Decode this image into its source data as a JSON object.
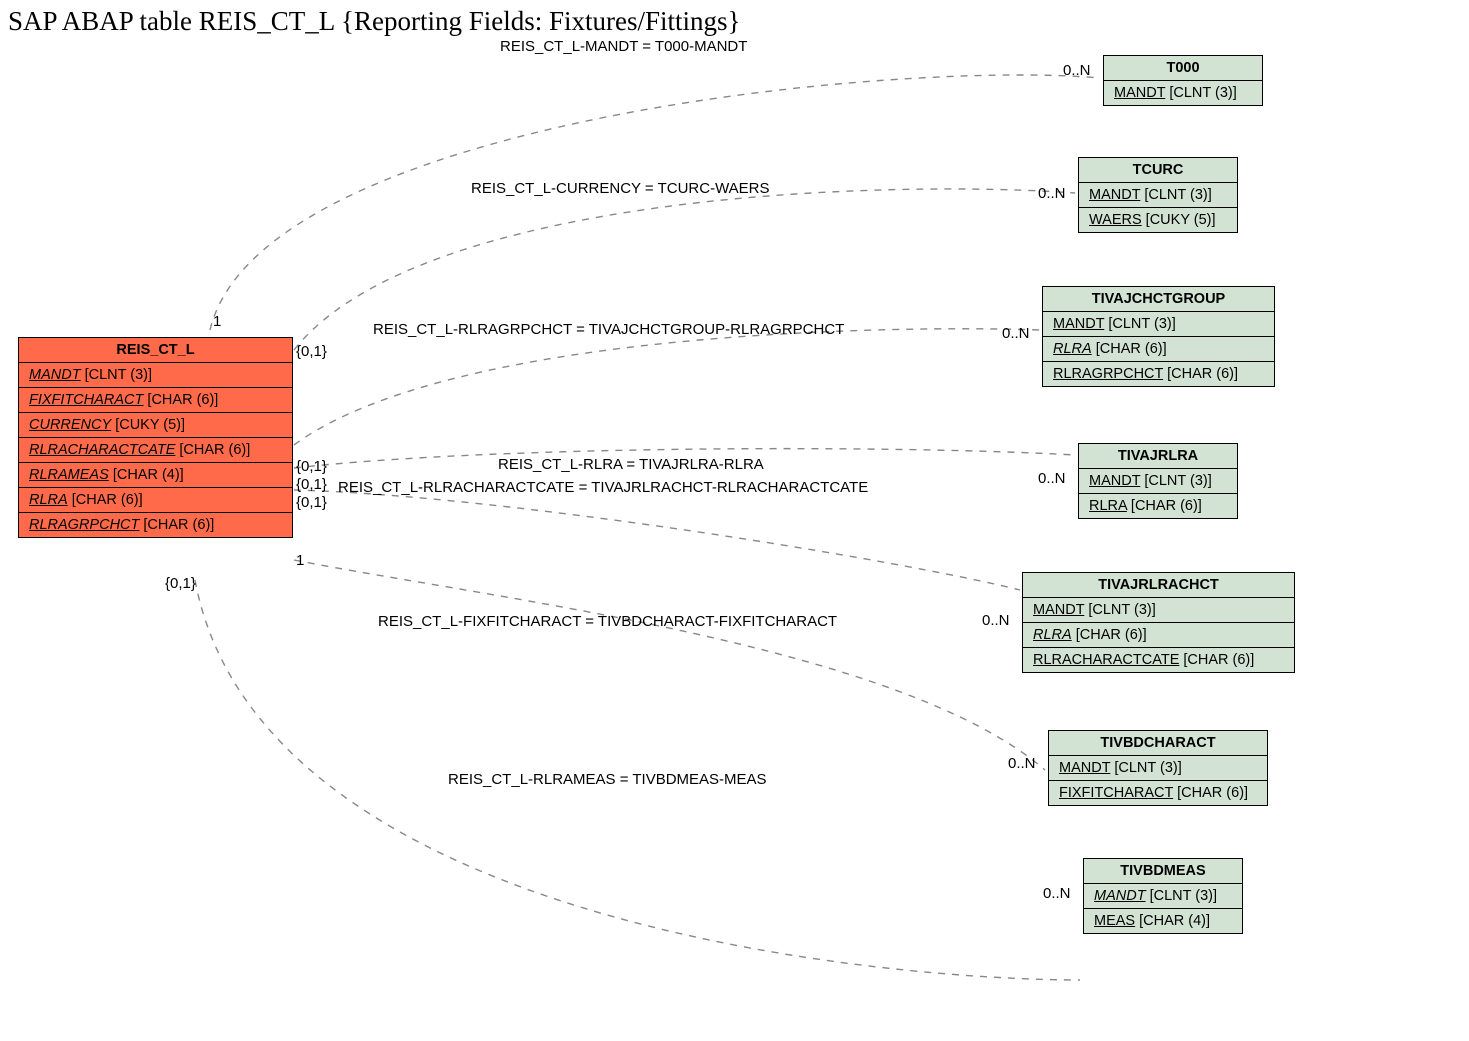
{
  "title": "SAP ABAP table REIS_CT_L {Reporting Fields: Fixtures/Fittings}",
  "main": {
    "name": "REIS_CT_L",
    "fields": [
      {
        "name": "MANDT",
        "type": "[CLNT (3)]",
        "italic": true
      },
      {
        "name": "FIXFITCHARACT",
        "type": "[CHAR (6)]",
        "italic": true
      },
      {
        "name": "CURRENCY",
        "type": "[CUKY (5)]",
        "italic": true
      },
      {
        "name": "RLRACHARACTCATE",
        "type": "[CHAR (6)]",
        "italic": true
      },
      {
        "name": "RLRAMEAS",
        "type": "[CHAR (4)]",
        "italic": true
      },
      {
        "name": "RLRA",
        "type": "[CHAR (6)]",
        "italic": true
      },
      {
        "name": "RLRAGRPCHCT",
        "type": "[CHAR (6)]",
        "italic": true
      }
    ]
  },
  "targets": {
    "t000": {
      "name": "T000",
      "fields": [
        {
          "name": "MANDT",
          "type": "[CLNT (3)]",
          "italic": false
        }
      ]
    },
    "tcurc": {
      "name": "TCURC",
      "fields": [
        {
          "name": "MANDT",
          "type": "[CLNT (3)]",
          "italic": false
        },
        {
          "name": "WAERS",
          "type": "[CUKY (5)]",
          "italic": false
        }
      ]
    },
    "tivajchctgroup": {
      "name": "TIVAJCHCTGROUP",
      "fields": [
        {
          "name": "MANDT",
          "type": "[CLNT (3)]",
          "italic": false
        },
        {
          "name": "RLRA",
          "type": "[CHAR (6)]",
          "italic": true
        },
        {
          "name": "RLRAGRPCHCT",
          "type": "[CHAR (6)]",
          "italic": false
        }
      ]
    },
    "tivajrlra": {
      "name": "TIVAJRLRA",
      "fields": [
        {
          "name": "MANDT",
          "type": "[CLNT (3)]",
          "italic": false
        },
        {
          "name": "RLRA",
          "type": "[CHAR (6)]",
          "italic": false
        }
      ]
    },
    "tivajrlrachct": {
      "name": "TIVAJRLRACHCT",
      "fields": [
        {
          "name": "MANDT",
          "type": "[CLNT (3)]",
          "italic": false
        },
        {
          "name": "RLRA",
          "type": "[CHAR (6)]",
          "italic": true
        },
        {
          "name": "RLRACHARACTCATE",
          "type": "[CHAR (6)]",
          "italic": false
        }
      ]
    },
    "tivbdcharact": {
      "name": "TIVBDCHARACT",
      "fields": [
        {
          "name": "MANDT",
          "type": "[CLNT (3)]",
          "italic": false
        },
        {
          "name": "FIXFITCHARACT",
          "type": "[CHAR (6)]",
          "italic": false
        }
      ]
    },
    "tivbdmeas": {
      "name": "TIVBDMEAS",
      "fields": [
        {
          "name": "MANDT",
          "type": "[CLNT (3)]",
          "italic": true
        },
        {
          "name": "MEAS",
          "type": "[CHAR (4)]",
          "italic": false
        }
      ]
    }
  },
  "labels": {
    "rel1": "REIS_CT_L-MANDT = T000-MANDT",
    "rel2": "REIS_CT_L-CURRENCY = TCURC-WAERS",
    "rel3": "REIS_CT_L-RLRAGRPCHCT = TIVAJCHCTGROUP-RLRAGRPCHCT",
    "rel4": "REIS_CT_L-RLRA = TIVAJRLRA-RLRA",
    "rel5": "REIS_CT_L-RLRACHARACTCATE = TIVAJRLRACHCT-RLRACHARACTCATE",
    "rel6": "REIS_CT_L-FIXFITCHARACT = TIVBDCHARACT-FIXFITCHARACT",
    "rel7": "REIS_CT_L-RLRAMEAS = TIVBDMEAS-MEAS",
    "c1l": "1",
    "c1r": "0..N",
    "c2l": "{0,1}",
    "c2r": "0..N",
    "c3l": "{0,1}",
    "c3r": "0..N",
    "c4l": "{0,1}",
    "c4r": "0..N",
    "c5l": "{0,1}",
    "c5r": "0..N",
    "c6l": "1",
    "c6r": "0..N",
    "c7l": "{0,1}",
    "c7r": "0..N"
  }
}
